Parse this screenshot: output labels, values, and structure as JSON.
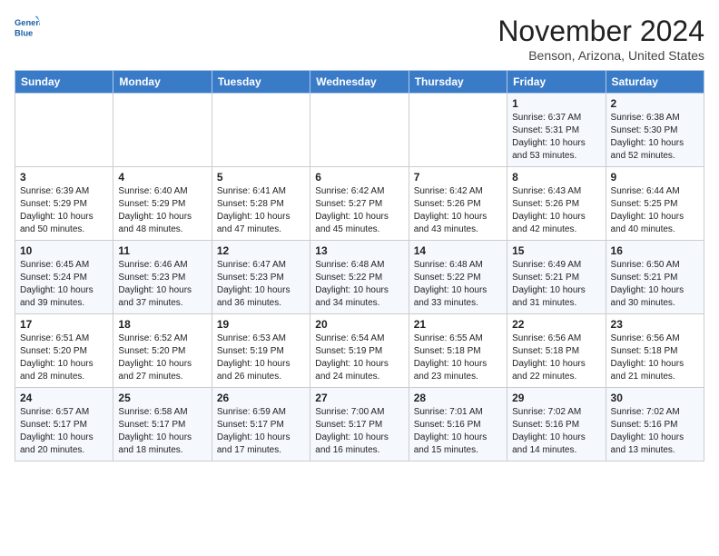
{
  "header": {
    "logo_line1": "General",
    "logo_line2": "Blue",
    "month": "November 2024",
    "location": "Benson, Arizona, United States"
  },
  "days_of_week": [
    "Sunday",
    "Monday",
    "Tuesday",
    "Wednesday",
    "Thursday",
    "Friday",
    "Saturday"
  ],
  "weeks": [
    [
      {
        "num": "",
        "sunrise": "",
        "sunset": "",
        "daylight": ""
      },
      {
        "num": "",
        "sunrise": "",
        "sunset": "",
        "daylight": ""
      },
      {
        "num": "",
        "sunrise": "",
        "sunset": "",
        "daylight": ""
      },
      {
        "num": "",
        "sunrise": "",
        "sunset": "",
        "daylight": ""
      },
      {
        "num": "",
        "sunrise": "",
        "sunset": "",
        "daylight": ""
      },
      {
        "num": "1",
        "sunrise": "Sunrise: 6:37 AM",
        "sunset": "Sunset: 5:31 PM",
        "daylight": "Daylight: 10 hours and 53 minutes."
      },
      {
        "num": "2",
        "sunrise": "Sunrise: 6:38 AM",
        "sunset": "Sunset: 5:30 PM",
        "daylight": "Daylight: 10 hours and 52 minutes."
      }
    ],
    [
      {
        "num": "3",
        "sunrise": "Sunrise: 6:39 AM",
        "sunset": "Sunset: 5:29 PM",
        "daylight": "Daylight: 10 hours and 50 minutes."
      },
      {
        "num": "4",
        "sunrise": "Sunrise: 6:40 AM",
        "sunset": "Sunset: 5:29 PM",
        "daylight": "Daylight: 10 hours and 48 minutes."
      },
      {
        "num": "5",
        "sunrise": "Sunrise: 6:41 AM",
        "sunset": "Sunset: 5:28 PM",
        "daylight": "Daylight: 10 hours and 47 minutes."
      },
      {
        "num": "6",
        "sunrise": "Sunrise: 6:42 AM",
        "sunset": "Sunset: 5:27 PM",
        "daylight": "Daylight: 10 hours and 45 minutes."
      },
      {
        "num": "7",
        "sunrise": "Sunrise: 6:42 AM",
        "sunset": "Sunset: 5:26 PM",
        "daylight": "Daylight: 10 hours and 43 minutes."
      },
      {
        "num": "8",
        "sunrise": "Sunrise: 6:43 AM",
        "sunset": "Sunset: 5:26 PM",
        "daylight": "Daylight: 10 hours and 42 minutes."
      },
      {
        "num": "9",
        "sunrise": "Sunrise: 6:44 AM",
        "sunset": "Sunset: 5:25 PM",
        "daylight": "Daylight: 10 hours and 40 minutes."
      }
    ],
    [
      {
        "num": "10",
        "sunrise": "Sunrise: 6:45 AM",
        "sunset": "Sunset: 5:24 PM",
        "daylight": "Daylight: 10 hours and 39 minutes."
      },
      {
        "num": "11",
        "sunrise": "Sunrise: 6:46 AM",
        "sunset": "Sunset: 5:23 PM",
        "daylight": "Daylight: 10 hours and 37 minutes."
      },
      {
        "num": "12",
        "sunrise": "Sunrise: 6:47 AM",
        "sunset": "Sunset: 5:23 PM",
        "daylight": "Daylight: 10 hours and 36 minutes."
      },
      {
        "num": "13",
        "sunrise": "Sunrise: 6:48 AM",
        "sunset": "Sunset: 5:22 PM",
        "daylight": "Daylight: 10 hours and 34 minutes."
      },
      {
        "num": "14",
        "sunrise": "Sunrise: 6:48 AM",
        "sunset": "Sunset: 5:22 PM",
        "daylight": "Daylight: 10 hours and 33 minutes."
      },
      {
        "num": "15",
        "sunrise": "Sunrise: 6:49 AM",
        "sunset": "Sunset: 5:21 PM",
        "daylight": "Daylight: 10 hours and 31 minutes."
      },
      {
        "num": "16",
        "sunrise": "Sunrise: 6:50 AM",
        "sunset": "Sunset: 5:21 PM",
        "daylight": "Daylight: 10 hours and 30 minutes."
      }
    ],
    [
      {
        "num": "17",
        "sunrise": "Sunrise: 6:51 AM",
        "sunset": "Sunset: 5:20 PM",
        "daylight": "Daylight: 10 hours and 28 minutes."
      },
      {
        "num": "18",
        "sunrise": "Sunrise: 6:52 AM",
        "sunset": "Sunset: 5:20 PM",
        "daylight": "Daylight: 10 hours and 27 minutes."
      },
      {
        "num": "19",
        "sunrise": "Sunrise: 6:53 AM",
        "sunset": "Sunset: 5:19 PM",
        "daylight": "Daylight: 10 hours and 26 minutes."
      },
      {
        "num": "20",
        "sunrise": "Sunrise: 6:54 AM",
        "sunset": "Sunset: 5:19 PM",
        "daylight": "Daylight: 10 hours and 24 minutes."
      },
      {
        "num": "21",
        "sunrise": "Sunrise: 6:55 AM",
        "sunset": "Sunset: 5:18 PM",
        "daylight": "Daylight: 10 hours and 23 minutes."
      },
      {
        "num": "22",
        "sunrise": "Sunrise: 6:56 AM",
        "sunset": "Sunset: 5:18 PM",
        "daylight": "Daylight: 10 hours and 22 minutes."
      },
      {
        "num": "23",
        "sunrise": "Sunrise: 6:56 AM",
        "sunset": "Sunset: 5:18 PM",
        "daylight": "Daylight: 10 hours and 21 minutes."
      }
    ],
    [
      {
        "num": "24",
        "sunrise": "Sunrise: 6:57 AM",
        "sunset": "Sunset: 5:17 PM",
        "daylight": "Daylight: 10 hours and 20 minutes."
      },
      {
        "num": "25",
        "sunrise": "Sunrise: 6:58 AM",
        "sunset": "Sunset: 5:17 PM",
        "daylight": "Daylight: 10 hours and 18 minutes."
      },
      {
        "num": "26",
        "sunrise": "Sunrise: 6:59 AM",
        "sunset": "Sunset: 5:17 PM",
        "daylight": "Daylight: 10 hours and 17 minutes."
      },
      {
        "num": "27",
        "sunrise": "Sunrise: 7:00 AM",
        "sunset": "Sunset: 5:17 PM",
        "daylight": "Daylight: 10 hours and 16 minutes."
      },
      {
        "num": "28",
        "sunrise": "Sunrise: 7:01 AM",
        "sunset": "Sunset: 5:16 PM",
        "daylight": "Daylight: 10 hours and 15 minutes."
      },
      {
        "num": "29",
        "sunrise": "Sunrise: 7:02 AM",
        "sunset": "Sunset: 5:16 PM",
        "daylight": "Daylight: 10 hours and 14 minutes."
      },
      {
        "num": "30",
        "sunrise": "Sunrise: 7:02 AM",
        "sunset": "Sunset: 5:16 PM",
        "daylight": "Daylight: 10 hours and 13 minutes."
      }
    ]
  ]
}
